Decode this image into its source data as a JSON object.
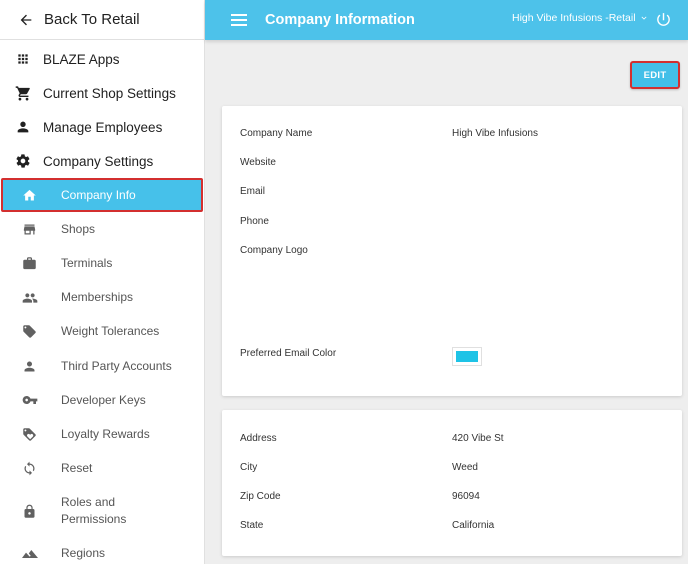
{
  "sidebar": {
    "back_label": "Back To Retail",
    "top_items": [
      {
        "label": "BLAZE Apps",
        "icon": "apps-grid-icon"
      },
      {
        "label": "Current Shop Settings",
        "icon": "shopping-cart-icon"
      },
      {
        "label": "Manage Employees",
        "icon": "person-icon"
      },
      {
        "label": "Company Settings",
        "icon": "gear-icon"
      }
    ],
    "sub_items": [
      {
        "label": "Company Info",
        "icon": "home-icon",
        "active": true
      },
      {
        "label": "Shops",
        "icon": "store-icon"
      },
      {
        "label": "Terminals",
        "icon": "briefcase-icon"
      },
      {
        "label": "Memberships",
        "icon": "people-icon"
      },
      {
        "label": "Weight Tolerances",
        "icon": "tag-icon"
      },
      {
        "label": "Third Party Accounts",
        "icon": "person-icon"
      },
      {
        "label": "Developer Keys",
        "icon": "key-icon"
      },
      {
        "label": "Loyalty Rewards",
        "icon": "loyalty-tag-icon"
      },
      {
        "label": "Reset",
        "icon": "refresh-icon"
      },
      {
        "label": "Roles and Permissions",
        "icon": "lock-icon"
      },
      {
        "label": "Regions",
        "icon": "terrain-icon"
      }
    ]
  },
  "header": {
    "title": "Company Information",
    "shop_selector": "High Vibe Infusions -Retail",
    "accent": "#4dc2ea"
  },
  "actions": {
    "edit_label": "EDIT"
  },
  "company": {
    "name_label": "Company Name",
    "name_value": "High Vibe Infusions",
    "website_label": "Website",
    "website_value": "",
    "email_label": "Email",
    "email_value": "",
    "phone_label": "Phone",
    "phone_value": "",
    "logo_label": "Company Logo",
    "email_color_label": "Preferred Email Color",
    "email_color_value": "#1ec3e6"
  },
  "address": {
    "address_label": "Address",
    "address_value": "420 Vibe St",
    "city_label": "City",
    "city_value": "Weed",
    "zip_label": "Zip Code",
    "zip_value": "96094",
    "state_label": "State",
    "state_value": "California"
  }
}
